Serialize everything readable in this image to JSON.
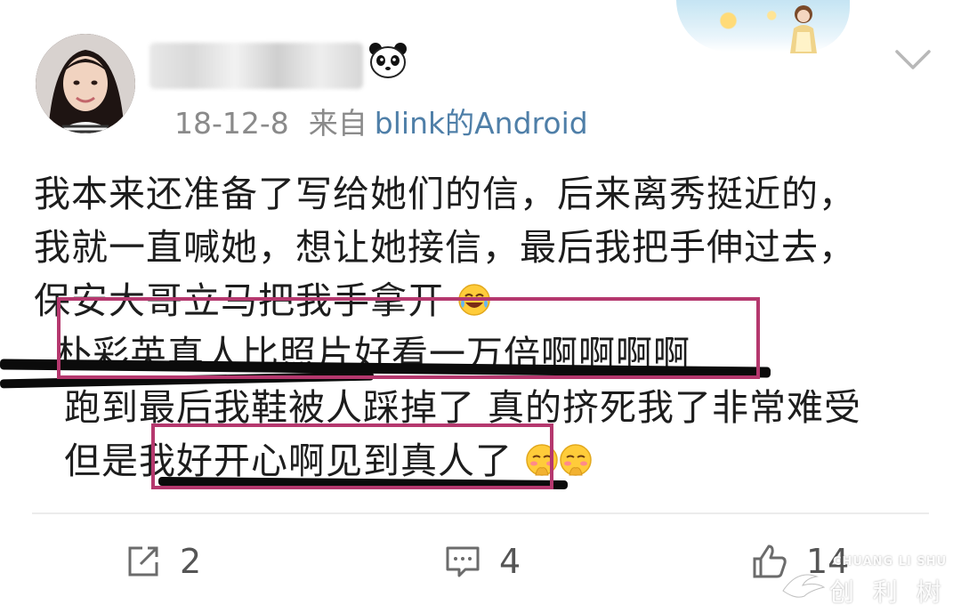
{
  "header": {
    "date": "18-12-8",
    "source_label": "来自",
    "source_name": "blink的Android"
  },
  "post": {
    "lines": [
      "我本来还准备了写给她们的信，后来离秀挺近的，",
      "我就一直喊她，想让她接信，最后我把手伸过去，",
      "保安大哥立马把我手拿开",
      "朴彩英真人比照片好看一万倍啊啊啊啊",
      "跑到最后我鞋被人踩掉了 真的挤死我了非常难受",
      "但是我好开心啊见到真人了"
    ]
  },
  "actions": {
    "repost_count": "2",
    "comment_count": "4",
    "like_count": "14"
  },
  "watermark": {
    "title": "CHUANG LI SHU",
    "subtitle": "创 利 树"
  },
  "icons": {
    "avatar": "avatar",
    "name_badge": "panda-icon",
    "menu": "chevron-down-icon",
    "repost": "share-icon",
    "comment": "comment-icon",
    "like": "thumbs-up-icon",
    "emoji_cry": "crying-laughing-emoji-icon",
    "emoji_shy": "shy-emoji-icon"
  },
  "colors": {
    "highlight_box": "#b5386e",
    "source_link": "#4f7fa8",
    "meta_text": "#8a8a8a"
  }
}
